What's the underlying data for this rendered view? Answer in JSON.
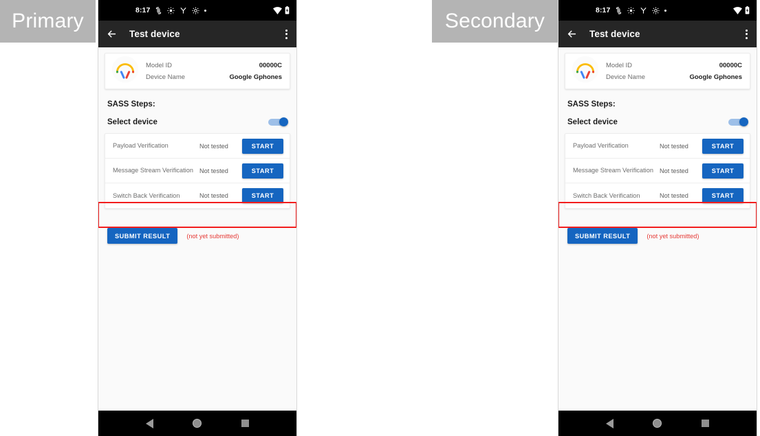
{
  "labels": {
    "primary": "Primary",
    "secondary": "Secondary"
  },
  "phone": {
    "status_bar": {
      "time": "8:17",
      "icons": [
        "sync-disabled-icon",
        "brightness-icon",
        "vpn-key-icon",
        "settings-gear-icon",
        "dot-icon"
      ],
      "wifi_icon": "wifi-icon",
      "battery_icon": "battery-icon"
    },
    "app_bar": {
      "back_icon": "back-arrow-icon",
      "title": "Test device",
      "overflow_icon": "overflow-menu-icon"
    },
    "device_card": {
      "icon": "headphones-icon",
      "rows": [
        {
          "key": "Model ID",
          "value": "00000C"
        },
        {
          "key": "Device Name",
          "value": "Google Gphones"
        }
      ]
    },
    "sass": {
      "title": "SASS Steps:",
      "select_device_label": "Select device",
      "toggle_state": "on",
      "steps": [
        {
          "name": "Payload Verification",
          "status": "Not tested",
          "action": "START"
        },
        {
          "name": "Message Stream Verification",
          "status": "Not tested",
          "action": "START"
        },
        {
          "name": "Switch Back Verification",
          "status": "Not tested",
          "action": "START"
        }
      ]
    },
    "submit": {
      "button_label": "SUBMIT RESULT",
      "note": "(not yet submitted)"
    },
    "nav_bar": {
      "back": "nav-back-icon",
      "home": "nav-home-icon",
      "recents": "nav-recents-icon"
    }
  },
  "colors": {
    "accent_blue": "#1565c0",
    "highlight_red": "#f21d1d",
    "note_red": "#e53935",
    "label_gray": "#b4b4b4",
    "app_bar": "#262626"
  }
}
